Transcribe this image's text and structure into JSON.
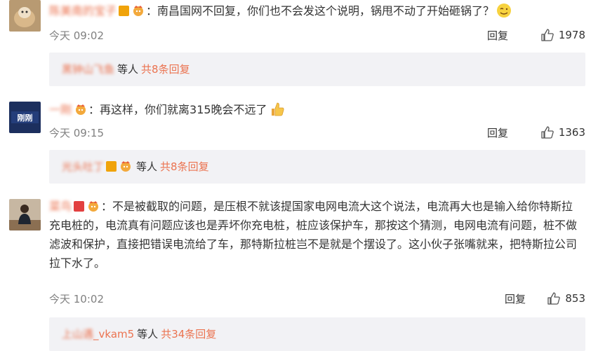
{
  "comments": [
    {
      "username": "陈美南的宝子",
      "text": "：南昌国网不回复，你们也不会发这个说明，锅甩不动了开始砸锅了？",
      "time": "今天 09:02",
      "reply_label": "回复",
      "likes": "1978",
      "sub_users": "黑钟山飞鱼",
      "sub_etc": "等人",
      "sub_total": "共8条回复"
    },
    {
      "username": "一刚",
      "text": "：再这样，你们就离315晚会不远了",
      "time": "今天 09:15",
      "reply_label": "回复",
      "likes": "1363",
      "sub_users": "光头吐丁",
      "sub_etc": "等人",
      "sub_total": "共8条回复"
    },
    {
      "username": "菜鸟",
      "text": "：不是被截取的问题，是压根不就该提国家电网电流大这个说法，电流再大也是输入给你特斯拉充电桩的，电流真有问题应该也是弄坏你充电桩，桩应该保护车，那按这个猜测，电网电流有问题，桩不做滤波和保护，直接把错误电流给了车，那特斯拉桩岂不是就是个摆设了。这小伙子张嘴就来，把特斯拉公司拉下水了。",
      "time": "今天 10:02",
      "reply_label": "回复",
      "likes": "853",
      "sub_users_blur": "上山遇",
      "sub_users_clear": "_vkam5",
      "sub_etc": "等人",
      "sub_total": "共34条回复"
    }
  ],
  "colors": {
    "username": "#eb7350",
    "reply_bg": "#f2f2f5",
    "meta": "#808080"
  },
  "icons": [
    "avatar-dog",
    "avatar-news-logo",
    "avatar-person",
    "verified-badge",
    "vip-badge",
    "cheeky-emoji",
    "thumbs-up-emoji",
    "like-thumb-icon"
  ]
}
